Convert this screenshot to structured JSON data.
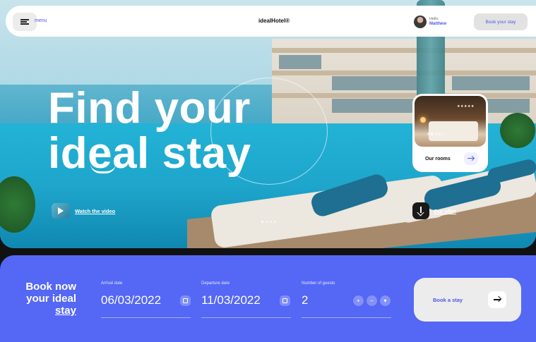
{
  "header": {
    "menu_label": "menu",
    "logo": "idealHotel®",
    "greeting": "Hello",
    "user_name": "Matthew",
    "book_button": "Book your stay"
  },
  "hero": {
    "headline_line1": "Find your",
    "headline_line2": "ideal stay",
    "watch_video": "Watch the video",
    "our_offer": "Our offer",
    "slides": 4,
    "active_slide": 1
  },
  "room_card": {
    "stars": "★★★★★",
    "rating": "4.8",
    "review_count": "(645)",
    "label": "Our rooms"
  },
  "booking": {
    "title_line1": "Book now",
    "title_line2": "your ideal",
    "title_line3": "stay",
    "arrival_label": "Arrival date",
    "arrival_value": "06/03/2022",
    "departure_label": "Departure date",
    "departure_value": "11/03/2022",
    "guests_label": "Number of guests",
    "guests_value": "2",
    "plus": "+",
    "minus": "–",
    "more": "▾",
    "submit": "Book a stay"
  },
  "colors": {
    "accent": "#5467f5",
    "accent_text": "#4b58e6"
  }
}
